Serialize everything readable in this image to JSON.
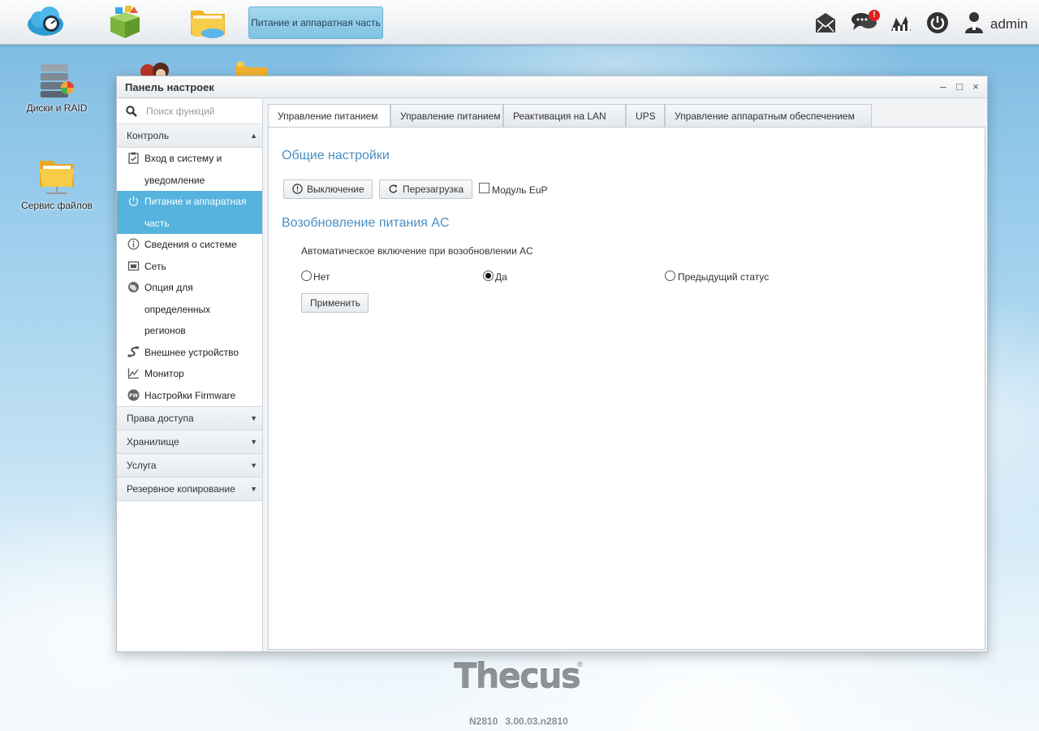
{
  "taskbar": {
    "apps": [
      {
        "name": "cloud-app-icon"
      },
      {
        "name": "app-center-icon"
      },
      {
        "name": "file-manager-icon"
      }
    ],
    "active_task": "Питание и аппаратная часть",
    "notification_badge": "!",
    "username": "admin"
  },
  "desktop": {
    "icons": [
      {
        "label": "Диски и RAID",
        "icon": "disk-raid-icon"
      },
      {
        "label": "Сервис файлов",
        "icon": "file-service-icon"
      }
    ]
  },
  "window": {
    "title": "Панель настроек",
    "controls": {
      "minimize": "–",
      "maximize": "□",
      "close": "×"
    }
  },
  "sidebar": {
    "search_placeholder": "Поиск функций",
    "groups": [
      {
        "label": "Контроль",
        "expanded": true,
        "arrow": "▲",
        "items": [
          {
            "label_lines": [
              "Вход в систему и",
              "уведомление"
            ],
            "icon": "clipboard-check-icon"
          },
          {
            "label_lines": [
              "Питание и аппаратная",
              "часть"
            ],
            "icon": "power-icon",
            "active": true
          },
          {
            "label_lines": [
              "Сведения о системе"
            ],
            "icon": "info-icon"
          },
          {
            "label_lines": [
              "Сеть"
            ],
            "icon": "network-port-icon"
          },
          {
            "label_lines": [
              "Опция для",
              "определенных",
              "регионов"
            ],
            "icon": "globe-icon"
          },
          {
            "label_lines": [
              "Внешнее устройство"
            ],
            "icon": "usb-device-icon"
          },
          {
            "label_lines": [
              "Монитор"
            ],
            "icon": "chart-monitor-icon"
          },
          {
            "label_lines": [
              "Настройки Firmware"
            ],
            "icon": "firmware-icon"
          }
        ]
      },
      {
        "label": "Права доступа",
        "arrow": "▼"
      },
      {
        "label": "Хранилище",
        "arrow": "▼"
      },
      {
        "label": "Услуга",
        "arrow": "▼"
      },
      {
        "label": "Резервное копирование",
        "arrow": "▼"
      }
    ]
  },
  "tabs": [
    {
      "label": "Управление питанием",
      "active": true
    },
    {
      "label": "Управление питанием"
    },
    {
      "label": "Реактивация на LAN"
    },
    {
      "label": "UPS"
    },
    {
      "label": "Управление аппаратным обеспечением"
    }
  ],
  "general": {
    "title": "Общие настройки",
    "shutdown_label": "Выключение",
    "reboot_label": "Перезагрузка",
    "eup_label": "Модуль EuP",
    "eup_checked": false
  },
  "ac_power": {
    "title": "Возобновление питания AC",
    "description": "Автоматическое включение при возобновлении AC",
    "options": [
      {
        "label": "Нет",
        "selected": false
      },
      {
        "label": "Да",
        "selected": true
      },
      {
        "label": "Предыдущий статус",
        "selected": false
      }
    ],
    "apply_label": "Применить"
  },
  "footer": {
    "brand": "Thecus",
    "registered": "®",
    "model": "N2810",
    "version": "3.00.03.n2810"
  }
}
